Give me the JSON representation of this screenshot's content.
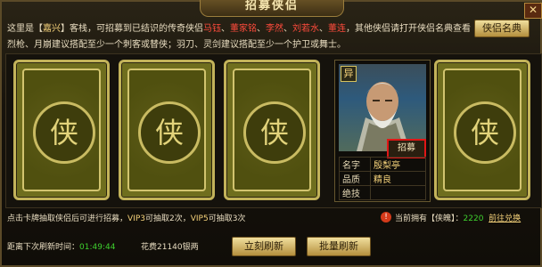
{
  "title": "招募侠侣",
  "close_icon": "✕",
  "top_button": "侠侣名典",
  "desc": {
    "l1_a": "这里是【",
    "town": "嘉兴",
    "l1_b": "】客栈，可招募到已结识的传奇侠侣",
    "n1": "马钰",
    "sep1": "、",
    "n2": "董家铭",
    "sep2": "、",
    "n3": "李然",
    "sep3": "、",
    "n4": "刘若水",
    "sep4": "、",
    "n5": "董连",
    "l1_c": "，其他侠侣请打开侠侣名典查看",
    "l2": "烈枪、月崩建议搭配至少一个刺客或替侠；羽刀、灵剑建议搭配至少一个护卫或舞士。"
  },
  "card_glyph": "侠",
  "hero": {
    "rarity": "异",
    "recruit_label": "招募",
    "rows": [
      {
        "k": "名字",
        "v": "殷梨亭"
      },
      {
        "k": "品质",
        "v": "精良"
      },
      {
        "k": "绝技",
        "v": ""
      }
    ]
  },
  "bottom": {
    "a": "点击卡牌抽取侠侣后可进行招募，",
    "vip3": "VIP3",
    "b": "可抽取2次，",
    "vip5": "VIP5",
    "c": "可抽取3次"
  },
  "owned": {
    "label": "当前拥有【侠魄】：",
    "value": "2220",
    "link": "前往兑换"
  },
  "refresh": {
    "label": "距离下次刷新时间：",
    "time": "01:49:44"
  },
  "cost": "花费21140银两",
  "btn_refresh_now": "立刻刷新",
  "btn_batch_refresh": "批量刷新"
}
